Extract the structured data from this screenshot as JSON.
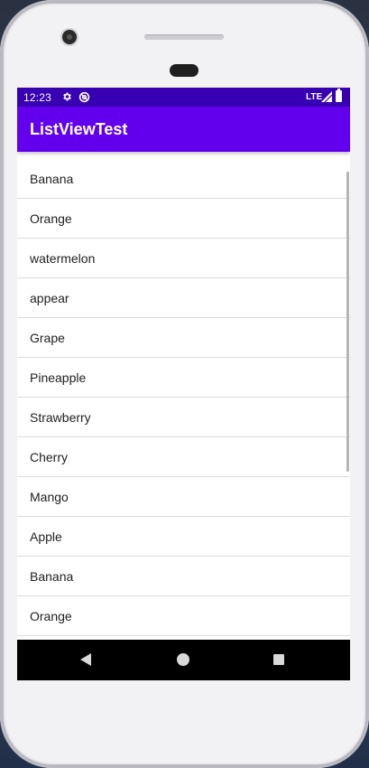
{
  "status_bar": {
    "time": "12:23",
    "network": "LTE"
  },
  "app_bar": {
    "title": "ListViewTest"
  },
  "list": {
    "items": [
      "Banana",
      "Orange",
      "watermelon",
      "appear",
      "Grape",
      "Pineapple",
      "Strawberry",
      "Cherry",
      "Mango",
      "Apple",
      "Banana",
      "Orange"
    ]
  },
  "colors": {
    "status_bar": "#3700b3",
    "app_bar": "#6200ee",
    "nav_bar": "#000000"
  },
  "icons": {
    "status": [
      "gear-icon",
      "sync-icon",
      "signal-icon",
      "battery-icon"
    ],
    "nav": [
      "back-icon",
      "home-icon",
      "recents-icon"
    ]
  }
}
